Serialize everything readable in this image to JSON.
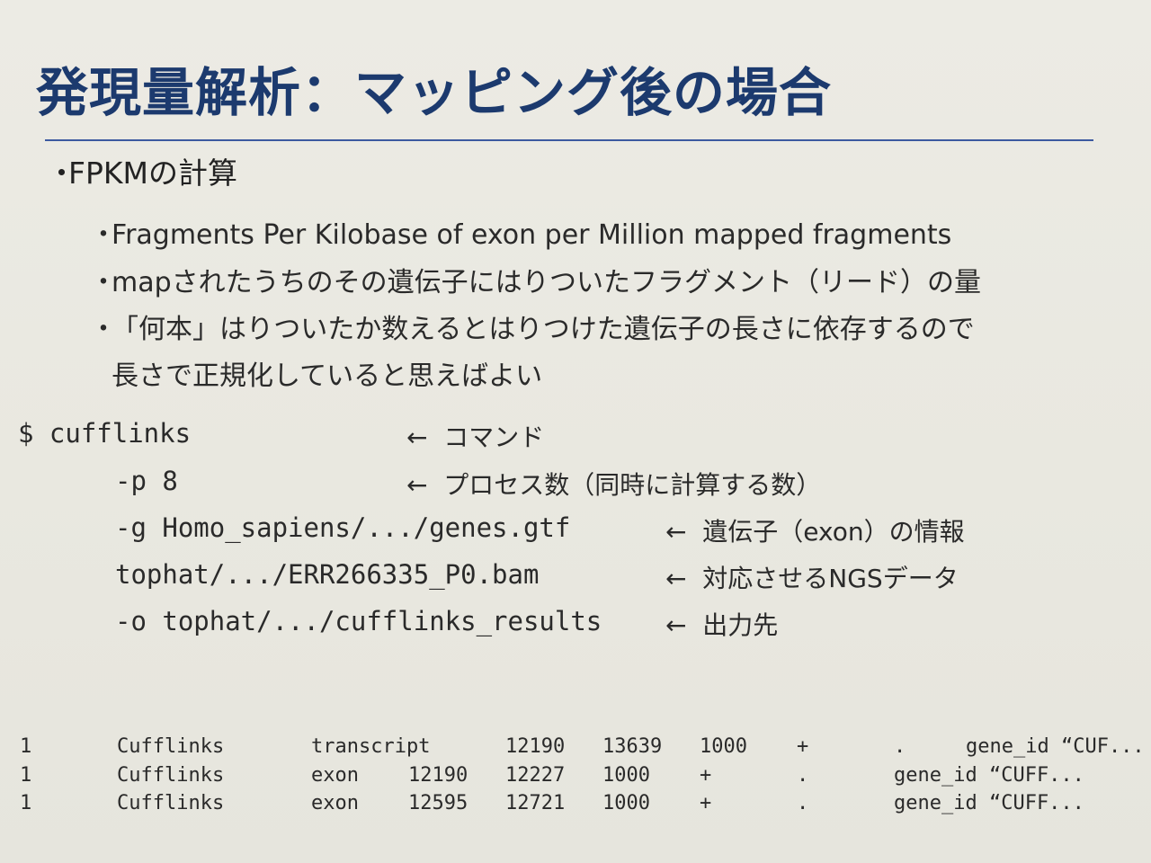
{
  "title": "発現量解析：マッピング後の場合",
  "bullets": {
    "main": "FPKMの計算",
    "sub": [
      "Fragments Per Kilobase of exon per Million mapped fragments",
      "mapされたうちのその遺伝子にはりついたフラグメント（リード）の量",
      "「何本」はりついたか数えるとはりつけた遺伝子の長さに依存するので",
      "長さで正規化していると思えばよい"
    ]
  },
  "bullet_marker": "・",
  "command": {
    "lines": [
      "$ cufflinks",
      "-p 8",
      "-g Homo_sapiens/.../genes.gtf",
      "tophat/.../ERR266335_P0.bam",
      "-o tophat/.../cufflinks_results"
    ],
    "arrow": "←",
    "notes": [
      "コマンド",
      "プロセス数（同時に計算する数）",
      "遺伝子（exon）の情報",
      "対応させるNGSデータ",
      "出力先"
    ]
  },
  "output_rows": [
    [
      "1",
      "Cufflinks",
      "transcript",
      "12190",
      "13639",
      "1000",
      "+",
      ".",
      "gene_id “CUF..."
    ],
    [
      "1",
      "Cufflinks",
      "exon",
      "12190",
      "12227",
      "1000",
      "+",
      ".",
      "gene_id “CUFF..."
    ],
    [
      "1",
      "Cufflinks",
      "exon",
      "12595",
      "12721",
      "1000",
      "+",
      ".",
      "gene_id “CUFF..."
    ]
  ]
}
